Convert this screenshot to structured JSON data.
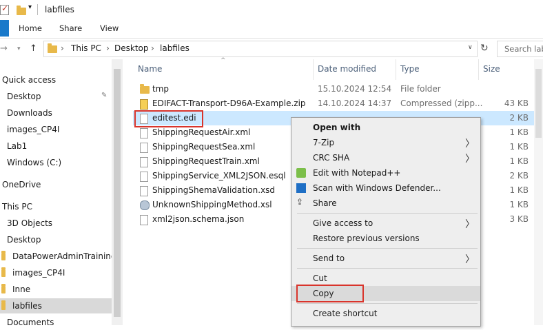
{
  "window": {
    "title": "labfiles"
  },
  "ribbon": {
    "tabs": [
      "Home",
      "Share",
      "View"
    ]
  },
  "address": {
    "segments": [
      "This PC",
      "Desktop",
      "labfiles"
    ],
    "sep": "›"
  },
  "search": {
    "placeholder": "Search labf"
  },
  "nav": {
    "items": [
      {
        "label": "Quick access"
      },
      {
        "label": "Desktop"
      },
      {
        "label": "Downloads"
      },
      {
        "label": "images_CP4I"
      },
      {
        "label": "Lab1"
      },
      {
        "label": "Windows (C:)"
      },
      {
        "label": "OneDrive"
      },
      {
        "label": "This PC"
      },
      {
        "label": "3D Objects"
      },
      {
        "label": "Desktop"
      },
      {
        "label": "DataPowerAdminTraining_"
      },
      {
        "label": "images_CP4I"
      },
      {
        "label": "Inne"
      },
      {
        "label": "labfiles"
      },
      {
        "label": "Documents"
      }
    ]
  },
  "columns": {
    "name": "Name",
    "date": "Date modified",
    "type": "Type",
    "size": "Size"
  },
  "files": [
    {
      "name": "tmp",
      "date": "15.10.2024 12:54",
      "type": "File folder",
      "size": "",
      "icon": "folder-icon"
    },
    {
      "name": "EDIFACT-Transport-D96A-Example.zip",
      "date": "14.10.2024 14:37",
      "type": "Compressed (zipp...",
      "size": "43 KB",
      "icon": "zip-icon"
    },
    {
      "name": "editest.edi",
      "date": "",
      "type": "",
      "size": "2 KB",
      "icon": "document-icon"
    },
    {
      "name": "ShippingRequestAir.xml",
      "date": "",
      "type": "",
      "size": "1 KB",
      "icon": "document-icon"
    },
    {
      "name": "ShippingRequestSea.xml",
      "date": "",
      "type": "",
      "size": "1 KB",
      "icon": "document-icon"
    },
    {
      "name": "ShippingRequestTrain.xml",
      "date": "",
      "type": "",
      "size": "1 KB",
      "icon": "document-icon"
    },
    {
      "name": "ShippingService_XML2JSON.esql",
      "date": "",
      "type": "",
      "size": "2 KB",
      "icon": "document-icon"
    },
    {
      "name": "ShippingShemaValidation.xsd",
      "date": "",
      "type": "",
      "size": "1 KB",
      "icon": "document-icon"
    },
    {
      "name": "UnknownShippingMethod.xsl",
      "date": "",
      "type": "",
      "size": "1 KB",
      "icon": "xsl-icon"
    },
    {
      "name": "xml2json.schema.json",
      "date": "",
      "type": "",
      "size": "3 KB",
      "icon": "document-icon"
    }
  ],
  "context_menu": {
    "items": [
      {
        "label": "Open with"
      },
      {
        "label": "7-Zip"
      },
      {
        "label": "CRC SHA"
      },
      {
        "label": "Edit with Notepad++"
      },
      {
        "label": "Scan with Windows Defender..."
      },
      {
        "label": "Share"
      },
      {
        "label": "Give access to"
      },
      {
        "label": "Restore previous versions"
      },
      {
        "label": "Send to"
      },
      {
        "label": "Cut"
      },
      {
        "label": "Copy"
      },
      {
        "label": "Create shortcut"
      }
    ],
    "submenu_arrow": "〉"
  },
  "colors": {
    "accent": "#1979ca",
    "selection": "#cce8ff",
    "highlight_box": "#d9342b",
    "folder": "#e8b94a"
  }
}
